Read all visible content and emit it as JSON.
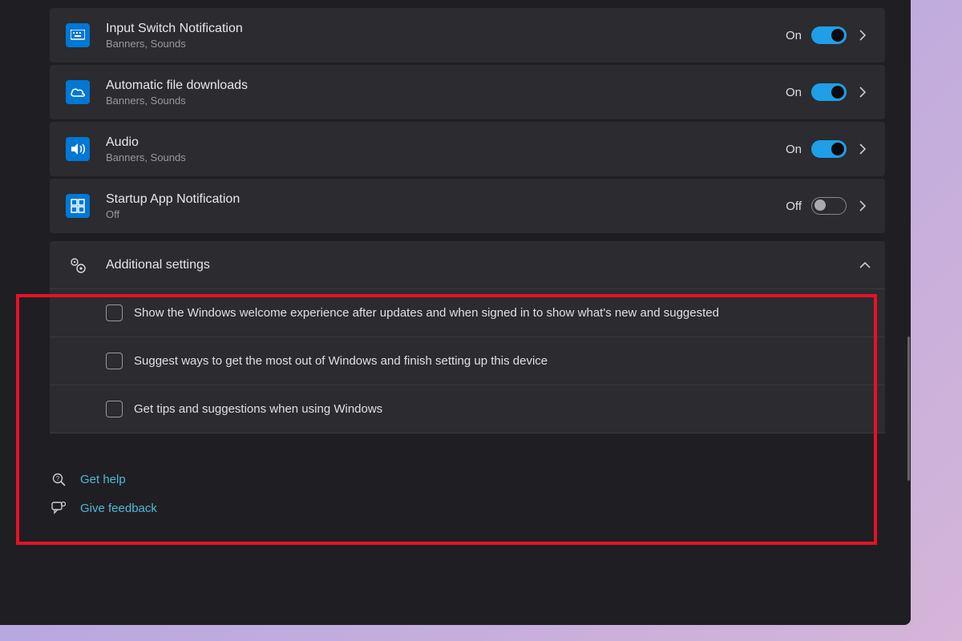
{
  "rows": [
    {
      "title": "Input Switch Notification",
      "subtitle": "Banners, Sounds",
      "state": "On",
      "on": true
    },
    {
      "title": "Automatic file downloads",
      "subtitle": "Banners, Sounds",
      "state": "On",
      "on": true
    },
    {
      "title": "Audio",
      "subtitle": "Banners, Sounds",
      "state": "On",
      "on": true
    },
    {
      "title": "Startup App Notification",
      "subtitle": "Off",
      "state": "Off",
      "on": false
    }
  ],
  "additional": {
    "title": "Additional settings",
    "options": [
      "Show the Windows welcome experience after updates and when signed in to show what's new and suggested",
      "Suggest ways to get the most out of Windows and finish setting up this device",
      "Get tips and suggestions when using Windows"
    ]
  },
  "footer": {
    "help": "Get help",
    "feedback": "Give feedback"
  }
}
